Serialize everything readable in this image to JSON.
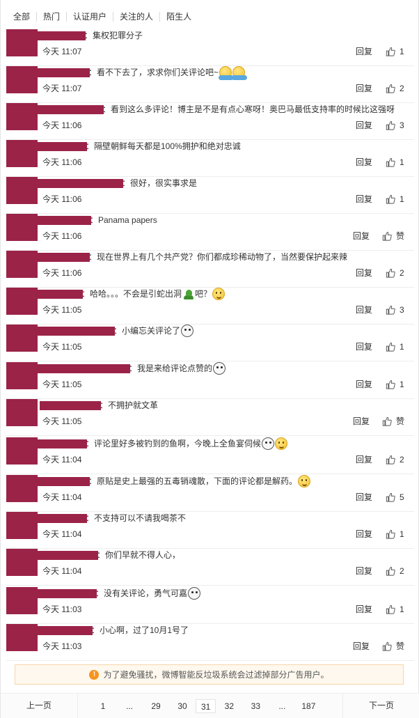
{
  "tabs": [
    {
      "label": "全部"
    },
    {
      "label": "热门"
    },
    {
      "label": "认证用户"
    },
    {
      "label": "关注的人"
    },
    {
      "label": "陌生人"
    }
  ],
  "labels": {
    "reply": "回复",
    "like_zero": "赞"
  },
  "colors": {
    "redacted": "#9b2348",
    "notice_bg": "#fff8ee",
    "notice_icon": "#f7931e"
  },
  "comments": [
    {
      "text": "集权犯罪分子",
      "time": "今天 11:07",
      "likes": "1",
      "emojis": []
    },
    {
      "text": "看不下去了，求求你们关评论吧~",
      "time": "今天 11:07",
      "likes": "2",
      "emojis": [
        "hug-emoji",
        "hug-emoji"
      ]
    },
    {
      "text": "看到这么多评论！博主是不是有点心寒呀！奥巴马最低支持率的时候比这强呀",
      "time": "今天 11:06",
      "likes": "3",
      "emojis": []
    },
    {
      "text": "隔壁朝鲜每天都是100%拥护和绝对忠诚",
      "time": "今天 11:06",
      "likes": "1",
      "emojis": []
    },
    {
      "text": "很好，很实事求是",
      "time": "今天 11:06",
      "likes": "1",
      "emojis": []
    },
    {
      "text": "Panama papers",
      "time": "今天 11:06",
      "likes": "赞",
      "emojis": []
    },
    {
      "text": "现在世界上有几个共产党？你们都成珍稀动物了，当然要保护起来辣",
      "time": "今天 11:06",
      "likes": "2",
      "emojis": []
    },
    {
      "text": "哈哈。。。不会是引蛇出洞",
      "text2": "吧？",
      "time": "今天 11:05",
      "likes": "3",
      "emojis": [
        "snake-emoji",
        "thinking-emoji"
      ]
    },
    {
      "text": "小编忘关评论了",
      "time": "今天 11:05",
      "likes": "1",
      "emojis": [
        "doge-emoji"
      ]
    },
    {
      "text": "我是来给评论点赞的",
      "time": "今天 11:05",
      "likes": "1",
      "emojis": [
        "doge-emoji"
      ]
    },
    {
      "text": "不拥护就文革",
      "time": "今天 11:05",
      "likes": "赞",
      "emojis": []
    },
    {
      "text": "评论里好多被钓到的鱼啊，今晚上全鱼宴伺候",
      "time": "今天 11:04",
      "likes": "2",
      "emojis": [
        "cat-emoji",
        "smile-emoji"
      ]
    },
    {
      "text": "原贴是史上最强的五毒销魂散，下面的评论都是解药。",
      "time": "今天 11:04",
      "likes": "5",
      "emojis": [
        "grin-emoji"
      ]
    },
    {
      "text": "不支持可以不请我喝茶不",
      "time": "今天 11:04",
      "likes": "1",
      "emojis": []
    },
    {
      "text": "你们早就不得人心，",
      "time": "今天 11:04",
      "likes": "2",
      "emojis": []
    },
    {
      "text": "没有关评论，勇气可嘉",
      "time": "今天 11:03",
      "likes": "1",
      "emojis": [
        "doge-emoji"
      ]
    },
    {
      "text": "小心啊，过了10月1号了",
      "time": "今天 11:03",
      "likes": "赞",
      "emojis": []
    }
  ],
  "notice": {
    "icon": "!",
    "text": "为了避免骚扰，微博智能反垃圾系统会过滤掉部分广告用户。"
  },
  "pagination": {
    "prev": "上一页",
    "next": "下一页",
    "pages": [
      "1",
      "...",
      "29",
      "30",
      "31",
      "32",
      "33",
      "...",
      "187"
    ],
    "current": "31"
  }
}
